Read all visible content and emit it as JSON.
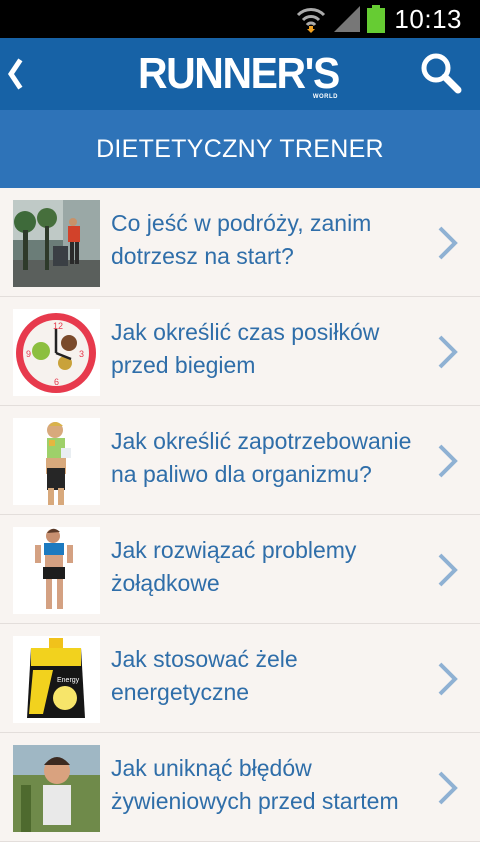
{
  "status_bar": {
    "time": "10:13"
  },
  "header": {
    "logo_text": "RUNNER'S",
    "logo_subtext": "WORLD"
  },
  "section": {
    "title": "DIETETYCZNY TRENER"
  },
  "articles": [
    {
      "title": "Co jeść w podróży, zanim dotrzesz na start?",
      "thumbnail": "travel-photo"
    },
    {
      "title": "Jak określić czas posiłków przed biegiem",
      "thumbnail": "clock-plate-photo"
    },
    {
      "title": "Jak określić zapotrzebowanie na paliwo dla organizmu?",
      "thumbnail": "runner-eating-photo"
    },
    {
      "title": "Jak rozwiązać problemy żołądkowe",
      "thumbnail": "runner-stomach-photo"
    },
    {
      "title": "Jak stosować żele energetyczne",
      "thumbnail": "energy-gel-photo"
    },
    {
      "title": "Jak uniknąć błędów żywieniowych przed startem",
      "thumbnail": "runner-outdoor-photo"
    }
  ],
  "colors": {
    "header": "#1762a6",
    "section": "#2e73b8",
    "link": "#2f6ea9",
    "chevron": "#8fb1d3"
  }
}
